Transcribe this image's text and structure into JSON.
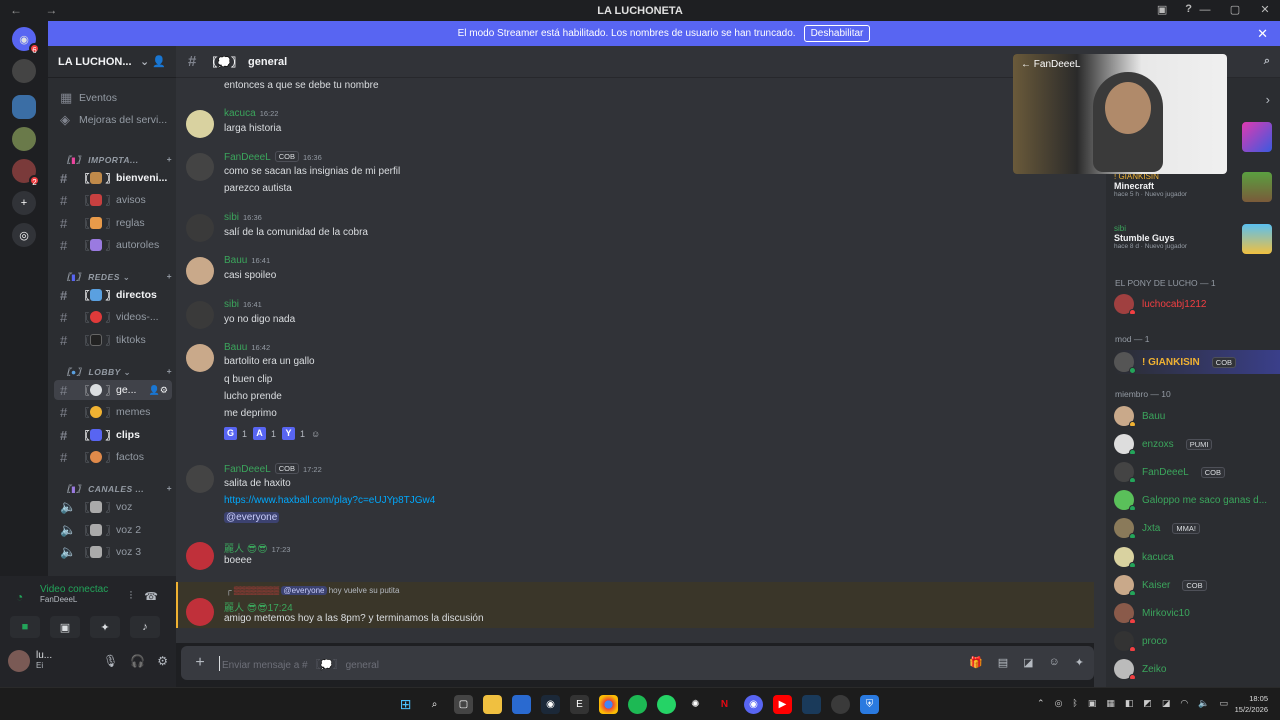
{
  "window": {
    "title": "LA LUCHONETA",
    "nav": "← →",
    "controls": [
      "—",
      "▢",
      "✕"
    ]
  },
  "banner": {
    "text": "El modo Streamer está habilitado. Los nombres de usuario se han truncado.",
    "button": "Deshabilitar"
  },
  "server": {
    "name": "LA LUCHON..."
  },
  "sidebar_top": [
    {
      "label": "Eventos"
    },
    {
      "label": "Mejoras del servi..."
    }
  ],
  "categories": [
    {
      "label": "IMPORTA..."
    },
    {
      "label": "REDES"
    },
    {
      "label": "LOBBY"
    },
    {
      "label": "CANALES ..."
    }
  ],
  "channels": [
    {
      "label": "bienveni..."
    },
    {
      "label": "avisos"
    },
    {
      "label": "reglas"
    },
    {
      "label": "autoroles"
    },
    {
      "label": "directos"
    },
    {
      "label": "videos-..."
    },
    {
      "label": "tiktoks"
    },
    {
      "label": "ge..."
    },
    {
      "label": "memes"
    },
    {
      "label": "clips"
    },
    {
      "label": "factos"
    },
    {
      "label": "voz"
    },
    {
      "label": "voz 2"
    },
    {
      "label": "voz 3"
    }
  ],
  "voice": {
    "status": "Video conectac",
    "sub": "FanDeeeL"
  },
  "me": {
    "name": "lu...",
    "sub": "Ei"
  },
  "chat": {
    "channel": "general",
    "lines": {
      "l0": "entonces a que se debe tu nombre",
      "l1": "larga historia",
      "l2": "como se sacan las insignias de mi perfil",
      "l3": "parezco autista",
      "l4": "salí de la comunidad de la cobra",
      "l5": "casi spoileo",
      "l6": "yo no digo nada",
      "l7": "bartolito era un gallo",
      "l8": "q buen clip",
      "l9": "lucho prende",
      "l10": "me deprimo",
      "l11": "salita de haxito",
      "l12": "https://www.haxball.com/play?c=eUJYp8TJGw4",
      "l13": "@everyone",
      "l14": "boeee",
      "l15": "amigo metemos hoy a las 8pm? y terminamos la discusión"
    },
    "authors": {
      "a0": {
        "name": "kacuca",
        "time": "16:22"
      },
      "a1": {
        "name": "FanDeeeL",
        "tag": "COB",
        "time": "16:36"
      },
      "a2": {
        "name": "sibi",
        "time": "16:36"
      },
      "a3": {
        "name": "Bauu",
        "time": "16:41"
      },
      "a4": {
        "name": "sibi",
        "time": "16:41"
      },
      "a5": {
        "name": "Bauu",
        "time": "16:42"
      },
      "a6": {
        "name": "FanDeeeL",
        "tag": "COB",
        "time": "17:22"
      },
      "a7": {
        "name": "麗人",
        "time": "17:23"
      },
      "a8": {
        "name": "麗人",
        "time": "17:24"
      }
    },
    "reactions": [
      {
        "letter": "G",
        "count": "1"
      },
      {
        "letter": "A",
        "count": "1"
      },
      {
        "letter": "Y",
        "count": "1"
      }
    ],
    "reply": {
      "mention": "@everyone",
      "text": "hoy vuelve su putita"
    },
    "input_placeholder": "Enviar mensaje a # 〖💭〗 general"
  },
  "video": {
    "label": "← FanDeeeL"
  },
  "activity": [
    {
      "name": "! GIANKISIN",
      "game": "Minecraft",
      "meta": "hace 5 h · Nuevo jugador"
    },
    {
      "name": "sibi",
      "game": "Stumble Guys",
      "meta": "hace 8 d · Nuevo jugador"
    }
  ],
  "groups": {
    "pony": "EL PONY DE LUCHO — 1",
    "mod": "mod — 1",
    "miembro": "miembro — 10"
  },
  "members": [
    {
      "name": "luchocabj1212",
      "color": "#f23f42"
    },
    {
      "name": "! GIANKISIN",
      "tag": "COB",
      "color": "#f0b232"
    },
    {
      "name": "Bauu",
      "color": "#3ba55c"
    },
    {
      "name": "enzoxs",
      "tag": "PUMI",
      "color": "#3ba55c"
    },
    {
      "name": "FanDeeeL",
      "tag": "COB",
      "color": "#3ba55c"
    },
    {
      "name": "Galoppo me saco ganas d...",
      "color": "#3ba55c"
    },
    {
      "name": "Jxta",
      "tag": "MMA!",
      "color": "#3ba55c"
    },
    {
      "name": "kacuca",
      "color": "#3ba55c"
    },
    {
      "name": "Kaiser",
      "tag": "COB",
      "color": "#3ba55c"
    },
    {
      "name": "Mirkovic10",
      "color": "#3ba55c"
    },
    {
      "name": "proco",
      "color": "#3ba55c"
    },
    {
      "name": "Zeiko",
      "color": "#3ba55c"
    }
  ],
  "clock": {
    "time": "18:05",
    "date": "15/2/2026"
  }
}
